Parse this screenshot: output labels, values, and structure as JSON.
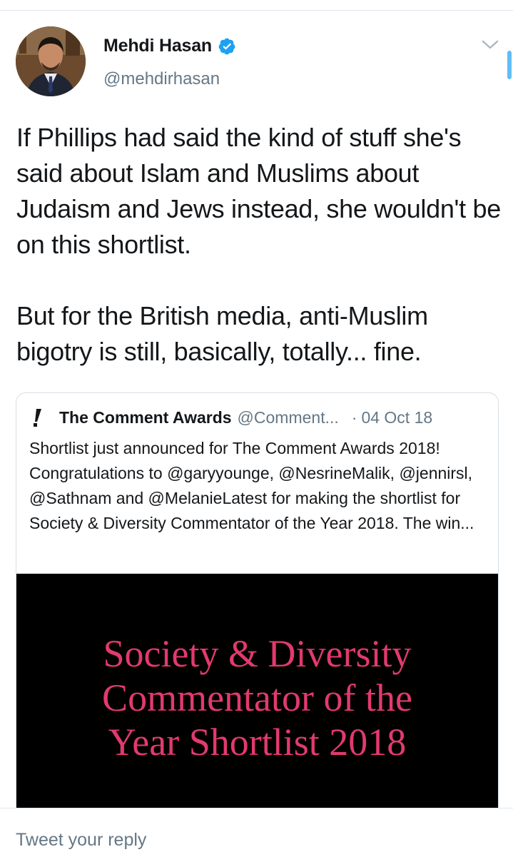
{
  "tweet": {
    "author_name": "Mehdi Hasan",
    "author_handle": "@mehdirhasan",
    "verified": true,
    "text": "If Phillips had said the kind of stuff she's said about Islam and Muslims about Judaism and Jews instead, she wouldn't be on this shortlist.\n\nBut for the British media, anti-Muslim bigotry is still, basically, totally... fine."
  },
  "quote": {
    "author_name": "The Comment Awards",
    "author_handle": "@Comment...",
    "separator": "·",
    "date": "04 Oct 18",
    "text": "Shortlist just announced for The Comment Awards 2018! Congratulations to @garyyounge, @NesrineMalik, @jennirsl, @Sathnam and @MelanieLatest for making the shortlist for Society & Diversity Commentator of the Year 2018. The win...",
    "media_text": "Society & Diversity\nCommentator of the\nYear Shortlist 2018"
  },
  "reply": {
    "placeholder": "Tweet your reply"
  },
  "icons": {
    "verified": "verified-badge-icon",
    "caret": "chevron-down-icon",
    "quote_logo": "exclamation-logo-icon"
  },
  "colors": {
    "accent": "#1da1f2",
    "secondary_text": "#657786",
    "media_text": "#e23a6e"
  }
}
